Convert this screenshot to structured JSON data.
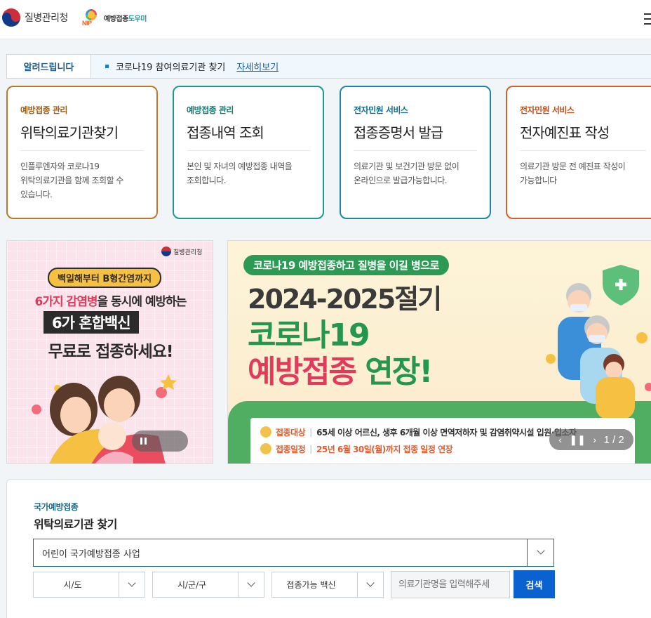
{
  "header": {
    "gov_name": "질병관리청",
    "nip_mark": "NIP",
    "nip_text_a": "예방접종",
    "nip_text_b": "도우미"
  },
  "notice": {
    "label": "알려드립니다",
    "text": "코로나19 참여의료기관 찾기",
    "link": "자세히보기"
  },
  "cards": [
    {
      "category": "예방접종 관리",
      "title": "위탁의료기관찾기",
      "desc_lines": [
        "인플루엔자와 코로나19",
        "위탁의료기관을 함께 조회할 수",
        "있습니다."
      ]
    },
    {
      "category": "예방접종 관리",
      "title": "접종내역 조회",
      "desc_lines": [
        "본인 및 자녀의 예방접종 내역을",
        "조회합니다."
      ]
    },
    {
      "category": "전자민원 서비스",
      "title": "접종증명서 발급",
      "desc_lines": [
        "의료기관 및 보건기관 방문 없이",
        "온라인으로 발급가능합니다."
      ]
    },
    {
      "category": "전자민원 서비스",
      "title": "전자예진표 작성",
      "desc_lines": [
        "의료기관 방문 전 예진표 작성이",
        "가능합니다"
      ]
    }
  ],
  "banner_left": {
    "brand": "질병관리청",
    "pill": "백일해부터 B형간염까지",
    "line1_hl": "6가지 감염병",
    "line1_rest": "을 동시에 예방하는",
    "line2": "6가 혼합백신",
    "line3": "무료로 접종하세요!"
  },
  "banner_right": {
    "pill": "코로나19 예방접종하고 질병을 이길 병으로",
    "year": "2024-2025절기",
    "covid": "코로나19",
    "extend_red": "예방접종",
    "extend_green": "연장!",
    "row1_label": "접종대상",
    "row1_value": "65세 이상 어르신, 생후 6개월 이상 면역저하자 및 감염취약시설 입원·입소자",
    "row2_label": "접종일정",
    "row2_value": "25년 6월 30일(월)까지 접종 일정 연장",
    "page": "1 / 2"
  },
  "search": {
    "category": "국가예방접종",
    "title": "위탁의료기관 찾기",
    "program": "어린이 국가예방접종 사업",
    "sido": "시/도",
    "sigungu": "시/군/구",
    "vaccine": "접종가능 백신",
    "input_placeholder": "의료기관명을 입력해주세",
    "button": "검색"
  },
  "colors": {
    "card1": "#b8782e",
    "card2": "#1c9a8e",
    "card3": "#1b86a6",
    "card4": "#d2602c",
    "search_button": "#0a62d1"
  }
}
